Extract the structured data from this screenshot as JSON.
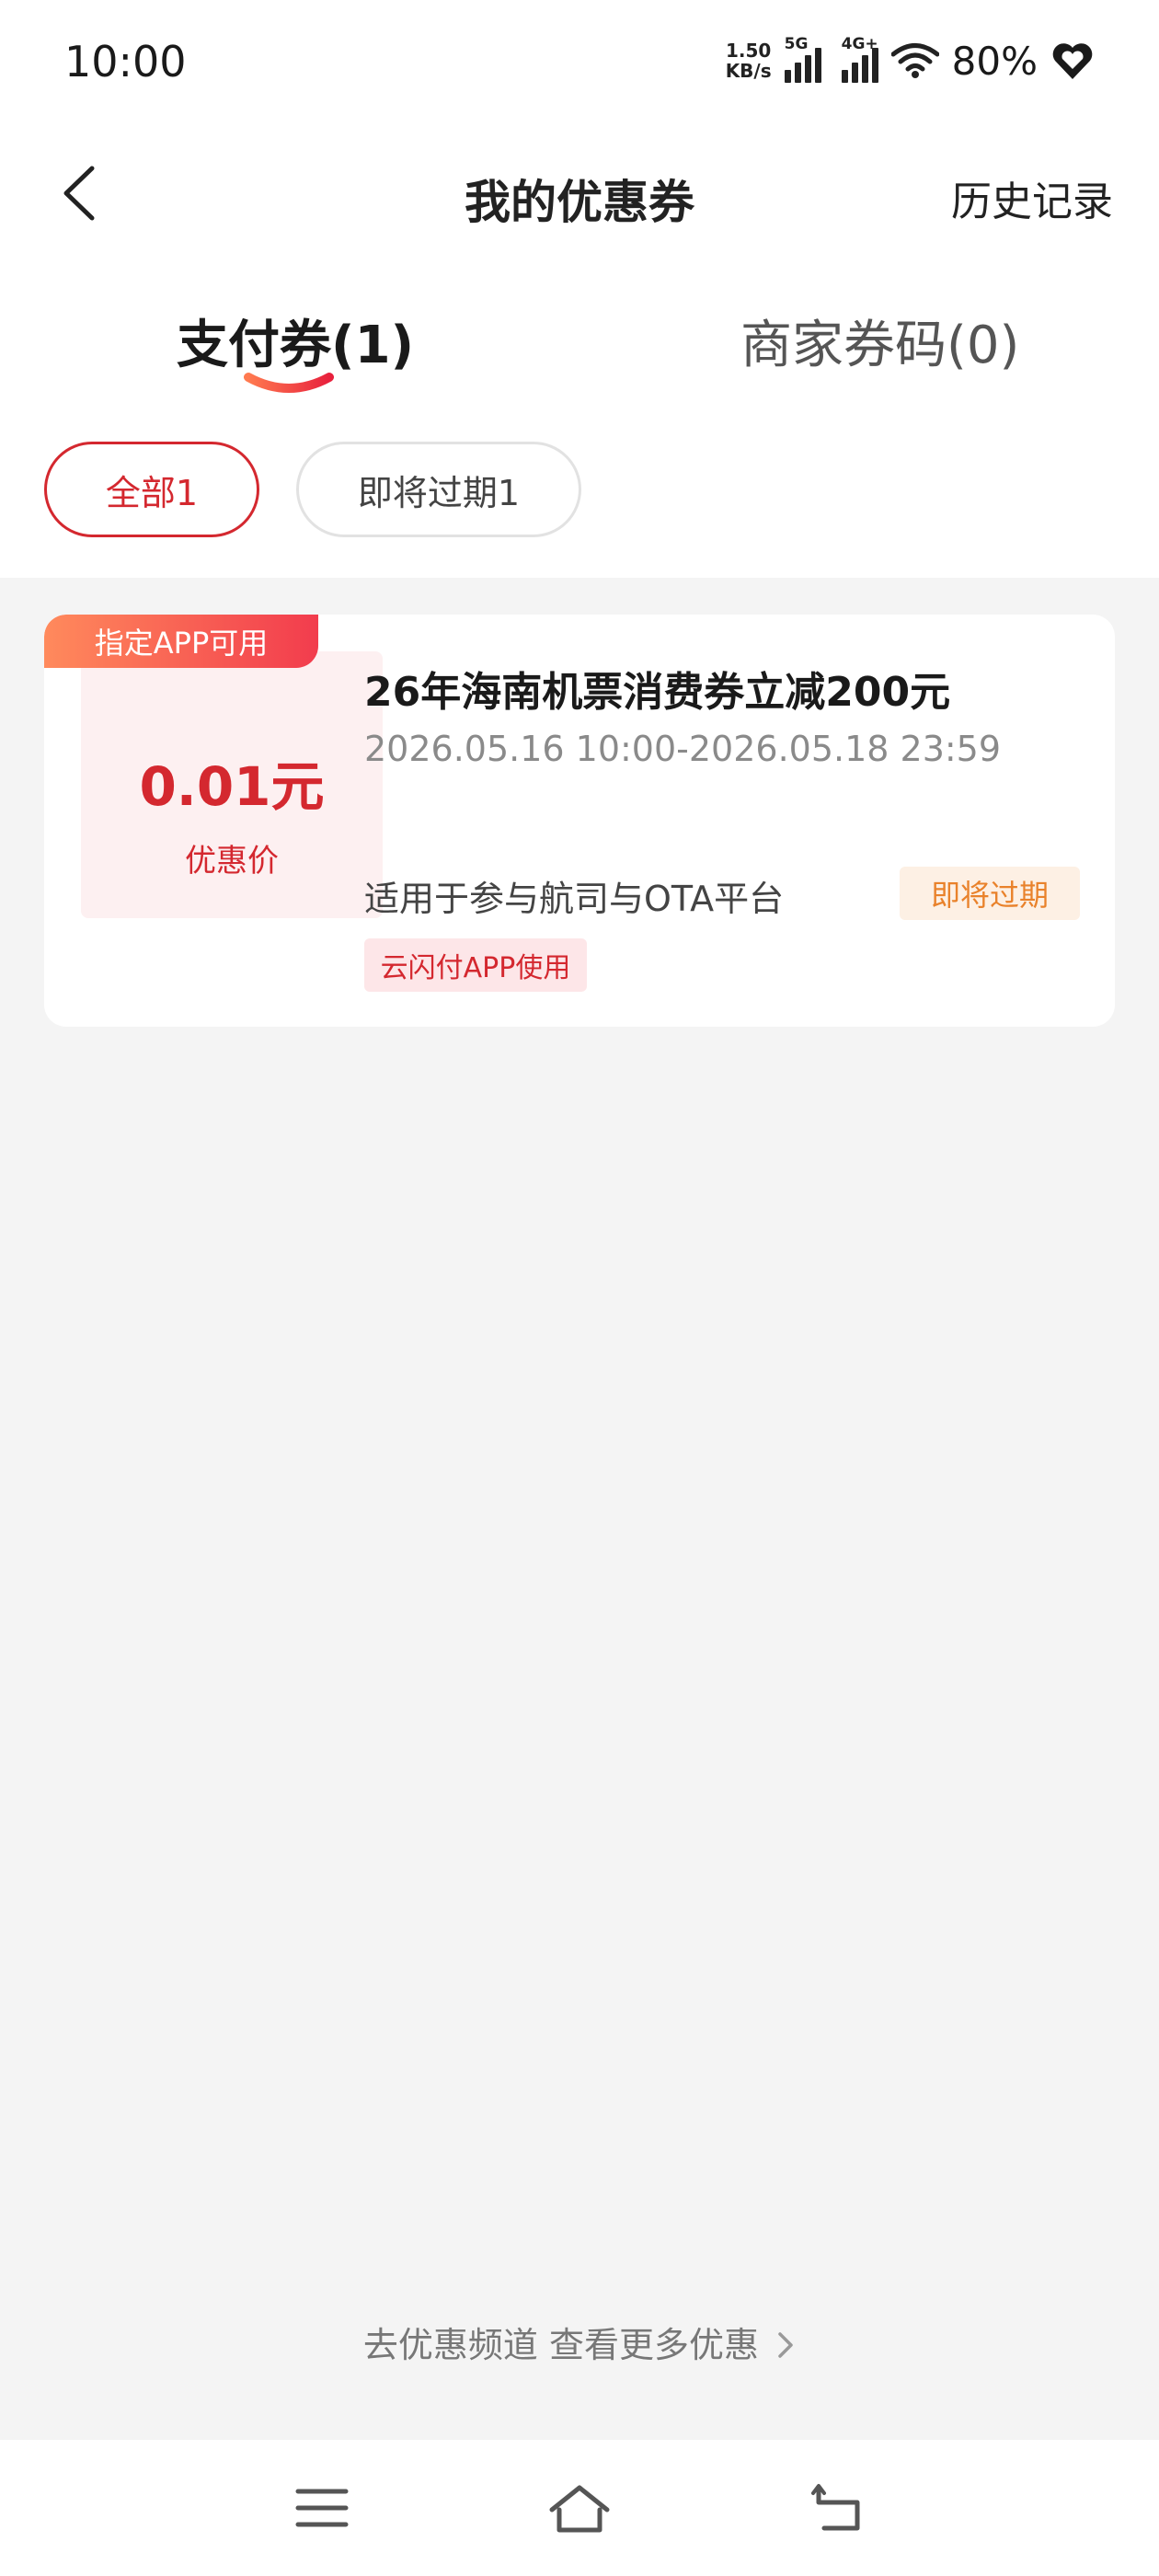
{
  "status_bar": {
    "time": "10:00",
    "net_speed_value": "1.50",
    "net_speed_unit": "KB/s",
    "sim1_type": "5G",
    "sim2_type": "4G+",
    "battery": "80%"
  },
  "nav": {
    "title": "我的优惠券",
    "history": "历史记录"
  },
  "tabs": [
    {
      "label": "支付券(1)"
    },
    {
      "label": "商家券码(0)"
    }
  ],
  "filters": [
    {
      "label": "全部1"
    },
    {
      "label": "即将过期1"
    }
  ],
  "coupon": {
    "corner_tag": "指定APP可用",
    "price": "0.01元",
    "price_label": "优惠价",
    "title": "26年海南机票消费券立减200元",
    "period": "2026.05.16 10:00-2026.05.18 23:59",
    "scope": "适用于参与航司与OTA平台",
    "expire_badge": "即将过期",
    "app_badge": "云闪付APP使用"
  },
  "footer_link": "去优惠频道 查看更多优惠",
  "colors": {
    "accent": "#d4282f",
    "warning": "#e9822b",
    "page_bg": "#f4f4f4"
  }
}
